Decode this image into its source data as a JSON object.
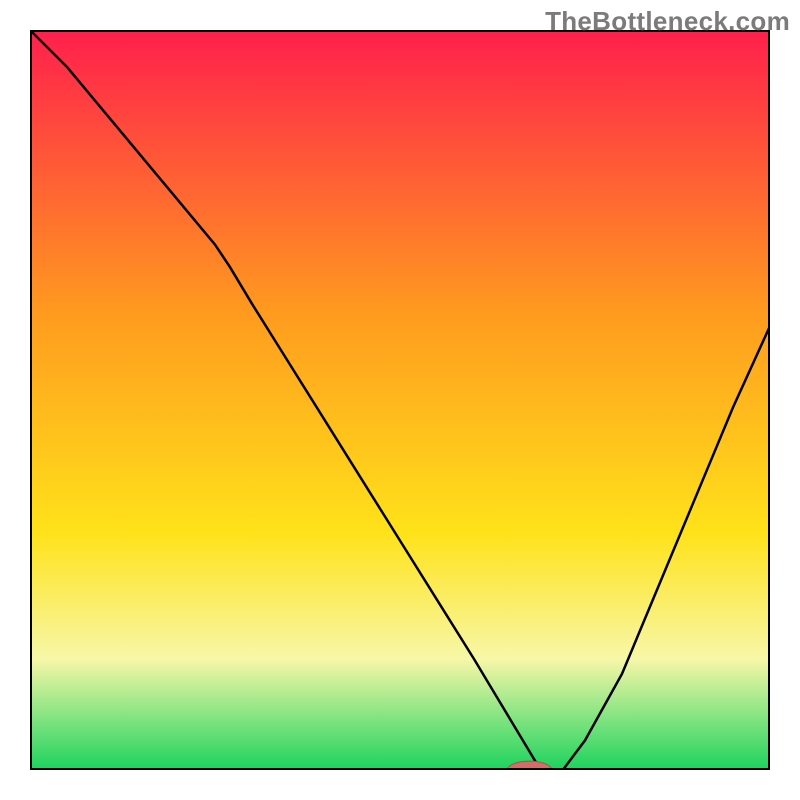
{
  "watermark": {
    "text": "TheBottleneck.com"
  },
  "colors": {
    "frame": "#000000",
    "curve": "#000000",
    "marker_fill": "#d96a6a",
    "marker_stroke": "#b24d4d",
    "gradient_top_red": "#ff1f4c",
    "gradient_orange": "#ff9a1f",
    "gradient_yellow": "#ffe21a",
    "gradient_pale_yellow": "#f7f7a8",
    "gradient_green": "#1bd35e"
  },
  "chart_data": {
    "type": "line",
    "title": "",
    "xlabel": "",
    "ylabel": "",
    "xlim": [
      0,
      100
    ],
    "ylim": [
      0,
      100
    ],
    "curve": {
      "x": [
        0,
        5,
        10,
        15,
        20,
        25,
        27,
        30,
        35,
        40,
        45,
        50,
        55,
        60,
        63,
        66,
        69,
        72,
        75,
        80,
        85,
        90,
        95,
        100
      ],
      "y": [
        100,
        95,
        89,
        83,
        77,
        71,
        68,
        63,
        55,
        47,
        39,
        31,
        23,
        15,
        10,
        5,
        0,
        0,
        4,
        13,
        25,
        37,
        49,
        60
      ]
    },
    "marker": {
      "x": 67.5,
      "y": 0,
      "rx": 3,
      "ry": 1.2
    },
    "background_gradient_stops": [
      {
        "offset": 0.0,
        "color_key": "gradient_top_red"
      },
      {
        "offset": 0.38,
        "color_key": "gradient_orange"
      },
      {
        "offset": 0.68,
        "color_key": "gradient_yellow"
      },
      {
        "offset": 0.85,
        "color_key": "gradient_pale_yellow"
      },
      {
        "offset": 1.0,
        "color_key": "gradient_green"
      }
    ]
  }
}
